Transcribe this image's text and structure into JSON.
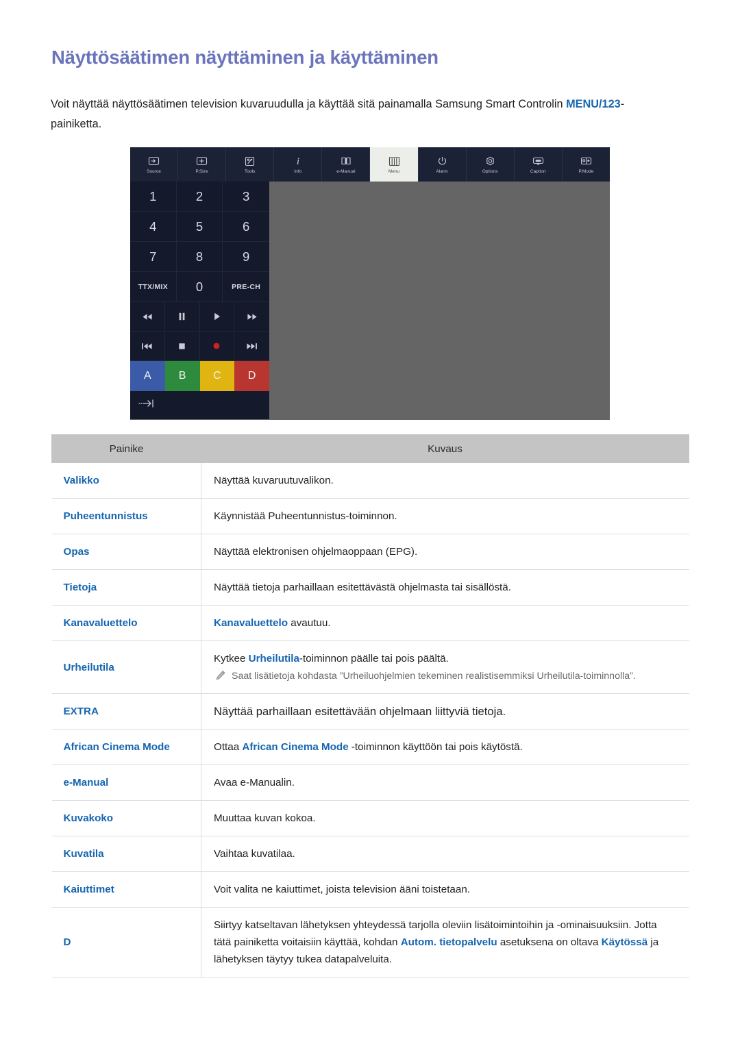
{
  "page": {
    "title": "Näyttösäätimen näyttäminen ja käyttäminen",
    "intro_part1": "Voit näyttää näyttösäätimen television kuvaruudulla ja käyttää sitä painamalla Samsung Smart Controlin ",
    "intro_keyword": "MENU/123",
    "intro_part2": "-painiketta."
  },
  "colors": {
    "title": "#6b74bc",
    "link": "#1565b0",
    "table_header_bg": "#c4c4c4",
    "panel_dark": "#141a2b",
    "toolbar_dark": "#1b2235",
    "toolbar_active_bg": "#eceeea",
    "figure_bg": "#656565",
    "color_a": "#3b5aa8",
    "color_b": "#2e8b3e",
    "color_c": "#e0b411",
    "color_d": "#b8362f",
    "record_red": "#cc2222"
  },
  "remote": {
    "toolbar": [
      {
        "icon": "source-icon",
        "label": "Source",
        "active": false
      },
      {
        "icon": "psize-icon",
        "label": "P.Size",
        "active": false
      },
      {
        "icon": "tools-icon",
        "label": "Tools",
        "active": false
      },
      {
        "icon": "info-icon",
        "label": "Info",
        "active": false
      },
      {
        "icon": "emanual-icon",
        "label": "e-Manual",
        "active": false
      },
      {
        "icon": "menu-icon",
        "label": "Menu",
        "active": true
      },
      {
        "icon": "alarm-icon",
        "label": "Alarm",
        "active": false
      },
      {
        "icon": "options-icon",
        "label": "Options",
        "active": false
      },
      {
        "icon": "caption-icon",
        "label": "Caption",
        "active": false
      },
      {
        "icon": "pmode-icon",
        "label": "P.Mode",
        "active": false
      }
    ],
    "numpad": [
      {
        "label": "1",
        "small": false
      },
      {
        "label": "2",
        "small": false
      },
      {
        "label": "3",
        "small": false
      },
      {
        "label": "4",
        "small": false
      },
      {
        "label": "5",
        "small": false
      },
      {
        "label": "6",
        "small": false
      },
      {
        "label": "7",
        "small": false
      },
      {
        "label": "8",
        "small": false
      },
      {
        "label": "9",
        "small": false
      },
      {
        "label": "TTX/MIX",
        "small": true
      },
      {
        "label": "0",
        "small": false
      },
      {
        "label": "PRE-CH",
        "small": true
      }
    ],
    "media": [
      {
        "icon": "rewind-icon"
      },
      {
        "icon": "pause-icon"
      },
      {
        "icon": "play-icon"
      },
      {
        "icon": "fast-forward-icon"
      },
      {
        "icon": "previous-icon"
      },
      {
        "icon": "stop-icon"
      },
      {
        "icon": "record-icon"
      },
      {
        "icon": "next-icon"
      }
    ],
    "color_buttons": [
      {
        "label": "A",
        "color": "#3b5aa8"
      },
      {
        "label": "B",
        "color": "#2e8b3e"
      },
      {
        "label": "C",
        "color": "#e0b411"
      },
      {
        "label": "D",
        "color": "#b8362f"
      }
    ],
    "bottom_icon": "jump-to-end-icon"
  },
  "table": {
    "headers": [
      "Painike",
      "Kuvaus"
    ],
    "rows": [
      {
        "key": "Valikko",
        "desc_pre": "Näyttää kuvaruutuvalikon.",
        "kw": "",
        "desc_post": "",
        "big": false
      },
      {
        "key": "Puheentunnistus",
        "desc_pre": "Käynnistää Puheentunnistus-toiminnon.",
        "kw": "",
        "desc_post": "",
        "big": false
      },
      {
        "key": "Opas",
        "desc_pre": "Näyttää elektronisen ohjelmaoppaan (EPG).",
        "kw": "",
        "desc_post": "",
        "big": false
      },
      {
        "key": "Tietoja",
        "desc_pre": "Näyttää tietoja parhaillaan esitettävästä ohjelmasta tai sisällöstä.",
        "kw": "",
        "desc_post": "",
        "big": false
      },
      {
        "key": "Kanavaluettelo",
        "desc_pre": "",
        "kw": "Kanavaluettelo",
        "desc_post": " avautuu.",
        "big": false
      },
      {
        "key": "Urheilutila",
        "desc_pre": "Kytkee ",
        "kw": "Urheilutila",
        "desc_post": "-toiminnon päälle tai pois päältä.",
        "note": "Saat lisätietoja kohdasta ”Urheiluohjelmien tekeminen realistisemmiksi Urheilutila-toiminnolla”.",
        "big": false
      },
      {
        "key": "EXTRA",
        "desc_pre": "Näyttää parhaillaan esitettävään ohjelmaan liittyviä tietoja.",
        "kw": "",
        "desc_post": "",
        "big": true
      },
      {
        "key": "African Cinema Mode",
        "desc_pre": "Ottaa ",
        "kw": "African Cinema Mode",
        "desc_post": " -toiminnon käyttöön tai pois käytöstä.",
        "big": false
      },
      {
        "key": "e-Manual",
        "desc_pre": "Avaa e-Manualin.",
        "kw": "",
        "desc_post": "",
        "big": false
      },
      {
        "key": "Kuvakoko",
        "desc_pre": "Muuttaa kuvan kokoa.",
        "kw": "",
        "desc_post": "",
        "big": false
      },
      {
        "key": "Kuvatila",
        "desc_pre": "Vaihtaa kuvatilaa.",
        "kw": "",
        "desc_post": "",
        "big": false
      },
      {
        "key": "Kaiuttimet",
        "desc_pre": "Voit valita ne kaiuttimet, joista television ääni toistetaan.",
        "kw": "",
        "desc_post": "",
        "big": false
      },
      {
        "key": "D",
        "desc_pre": "Siirtyy katseltavan lähetyksen yhteydessä tarjolla oleviin lisätoimintoihin ja -ominaisuuksiin. Jotta tätä painiketta voitaisiin käyttää, kohdan ",
        "kw": "Autom. tietopalvelu",
        "desc_post": " asetuksena on oltava ",
        "kw2": "Käytössä",
        "desc_post2": " ja lähetyksen täytyy tukea datapalveluita.",
        "big": false
      }
    ]
  }
}
